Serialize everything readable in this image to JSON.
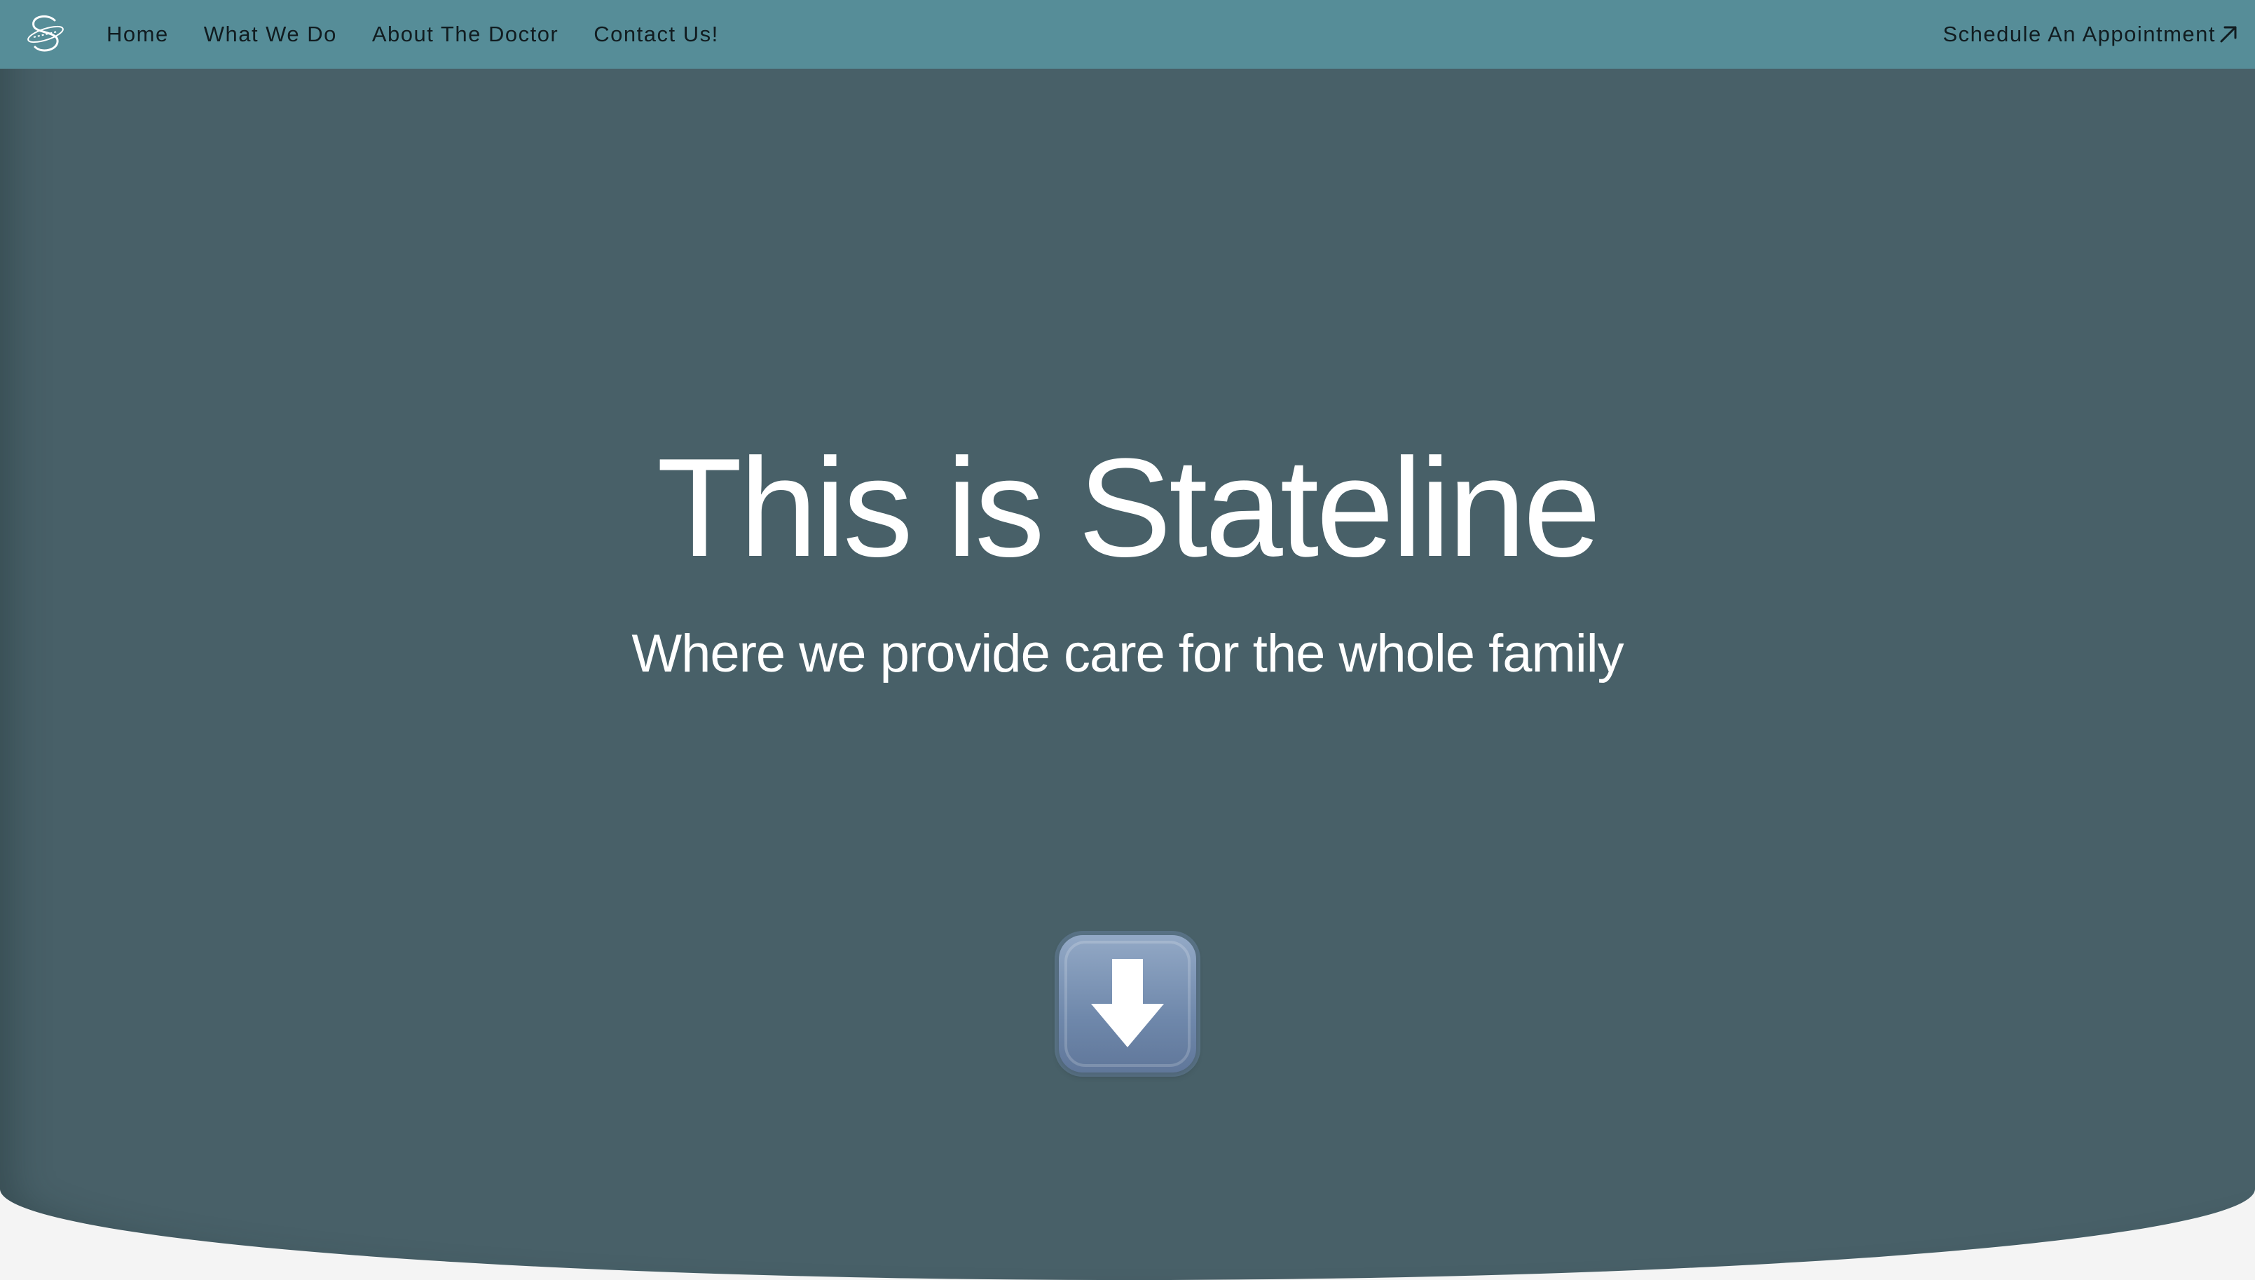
{
  "header": {
    "nav_items": [
      {
        "label": "Home"
      },
      {
        "label": "What We Do"
      },
      {
        "label": "About The Doctor"
      },
      {
        "label": "Contact Us!"
      }
    ],
    "cta_label": "Schedule An Appointment",
    "logo_icon": "stateline-logo-icon",
    "cta_icon": "arrow-up-right-icon"
  },
  "hero": {
    "title": "This is Stateline",
    "subtitle": "Where we provide care for the whole family",
    "scroll_icon": "down-arrow-icon"
  },
  "colors": {
    "topbar": "#568d98",
    "hero_background": "#486068",
    "page_background": "#f4f4f4",
    "text_light": "#ffffff",
    "text_dark": "#111c20"
  }
}
